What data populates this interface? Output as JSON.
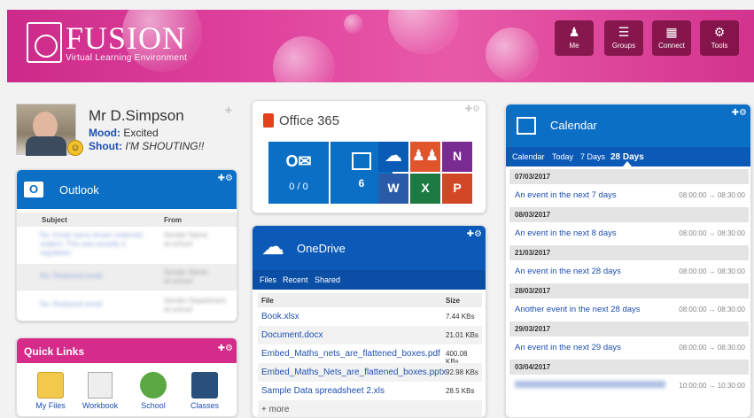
{
  "brand": {
    "name": "FUSION",
    "tagline": "Virtual Learning Environment"
  },
  "nav": [
    {
      "label": "Me",
      "icon": "person-icon"
    },
    {
      "label": "Groups",
      "icon": "stack-icon"
    },
    {
      "label": "Connect",
      "icon": "connect-icon"
    },
    {
      "label": "Tools",
      "icon": "tools-icon"
    }
  ],
  "profile": {
    "name": "Mr D.Simpson",
    "mood_label": "Mood:",
    "mood": "Excited",
    "shout_label": "Shout:",
    "shout": "I'M SHOUTING!!"
  },
  "outlook": {
    "title": "Outlook",
    "col_subject": "Subject",
    "col_from": "From"
  },
  "quicklinks": {
    "title": "Quick Links",
    "items": [
      {
        "label": "My Files"
      },
      {
        "label": "Workbook"
      },
      {
        "label": "School"
      },
      {
        "label": "Classes"
      }
    ]
  },
  "office": {
    "title": "Office 365",
    "mail_count": "0 / 0",
    "calendar_count": "6"
  },
  "onedrive": {
    "title": "OneDrive",
    "tabs": [
      "Files",
      "Recent",
      "Shared"
    ],
    "col_file": "File",
    "col_size": "Size",
    "files": [
      {
        "name": "Book.xlsx",
        "size": "7.44 KBs"
      },
      {
        "name": "Document.docx",
        "size": "21.01 KBs"
      },
      {
        "name": "Embed_Maths_nets_are_flattened_boxes.pdf",
        "size": "400.08 KBs"
      },
      {
        "name": "Embed_Maths_Nets_are_flattened_boxes.pptx",
        "size": "92.98 KBs"
      },
      {
        "name": "Sample Data spreadsheet 2.xls",
        "size": "28.5 KBs"
      }
    ],
    "more": "+ more"
  },
  "calendar": {
    "title": "Calendar",
    "tabs": [
      "Calendar",
      "Today",
      "7 Days",
      "28 Days"
    ],
    "active_tab": "28 Days",
    "groups": [
      {
        "date": "07/03/2017",
        "event": "An event in the next 7 days",
        "time": "08:00:00 → 08:30:00"
      },
      {
        "date": "08/03/2017",
        "event": "An event in the next 8 days",
        "time": "08:00:00 → 08:30:00"
      },
      {
        "date": "21/03/2017",
        "event": "An event in the next 28 days",
        "time": "08:00:00 → 08:30:00"
      },
      {
        "date": "28/03/2017",
        "event": "Another event in the next 28 days",
        "time": "08:00:00 → 08:30:00"
      },
      {
        "date": "29/03/2017",
        "event": "An event in the next 29 days",
        "time": "08:00:00 → 08:30:00"
      },
      {
        "date": "03/04/2017",
        "event": "",
        "time": "10:00:00 → 10:30:00"
      }
    ]
  },
  "colors": {
    "header": "#d83594",
    "outlook_blue": "#0b6fc6",
    "onedrive_blue": "#0b5ab8",
    "office_orange": "#e3401c",
    "quicklinks_pink": "#d52b8a"
  }
}
